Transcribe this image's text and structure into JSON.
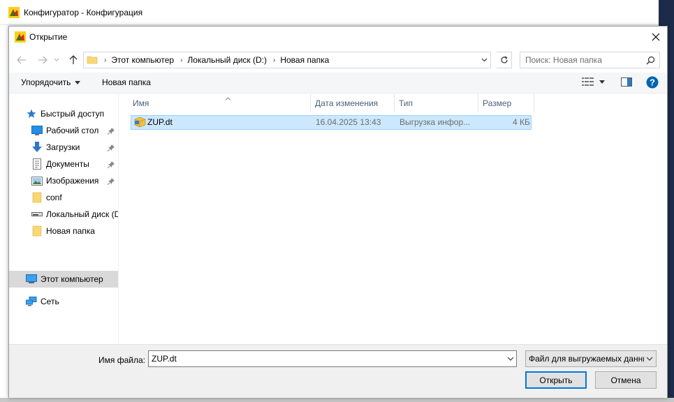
{
  "parent_window": {
    "title": "Конфигуратор - Конфигурация"
  },
  "dialog": {
    "title": "Открытие"
  },
  "address": {
    "crumbs": [
      "Этот компьютер",
      "Локальный диск (D:)",
      "Новая папка"
    ]
  },
  "search": {
    "placeholder": "Поиск: Новая папка"
  },
  "toolbar": {
    "organize_label": "Упорядочить",
    "new_folder_label": "Новая папка"
  },
  "nav": {
    "items": [
      {
        "label": "Быстрый доступ",
        "icon": "star-icon"
      },
      {
        "label": "Рабочий стол",
        "icon": "desktop-icon",
        "pinned": true
      },
      {
        "label": "Загрузки",
        "icon": "download-icon",
        "pinned": true
      },
      {
        "label": "Документы",
        "icon": "document-icon",
        "pinned": true
      },
      {
        "label": "Изображения",
        "icon": "pictures-icon",
        "pinned": true
      },
      {
        "label": "conf",
        "icon": "folder-icon"
      },
      {
        "label": "Локальный диск (D",
        "icon": "drive-icon"
      },
      {
        "label": "Новая папка",
        "icon": "folder-icon"
      },
      {
        "label": "Этот компьютер",
        "icon": "computer-icon",
        "selected": true
      },
      {
        "label": "Сеть",
        "icon": "network-icon"
      }
    ]
  },
  "file_list": {
    "columns": [
      "Имя",
      "Дата изменения",
      "Тип",
      "Размер"
    ],
    "rows": [
      {
        "name": "ZUP.dt",
        "modified": "16.04.2025 13:43",
        "type": "Выгрузка инфор...",
        "size": "4 КБ"
      }
    ]
  },
  "footer": {
    "filename_label": "Имя файла:",
    "filename_value": "ZUP.dt",
    "filetype_value": "Файл для выгружаемых данных",
    "open_label": "Открыть",
    "cancel_label": "Отмена"
  },
  "colors": {
    "accent": "#0078d7",
    "selection": "#cce8ff",
    "help": "#0063b1"
  }
}
